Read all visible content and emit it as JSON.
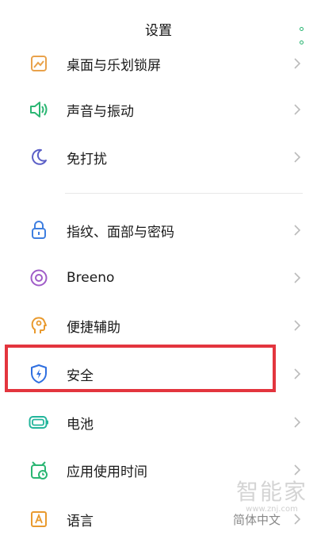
{
  "header": {
    "title": "设置"
  },
  "items": [
    {
      "label": "桌面与乐划锁屏",
      "icon": "wallpaper-icon",
      "color": "#e9a24b"
    },
    {
      "label": "声音与振动",
      "icon": "speaker-icon",
      "color": "#2bb673"
    },
    {
      "label": "免打扰",
      "icon": "moon-icon",
      "color": "#5b5fc7"
    },
    {
      "label": "指纹、面部与密码",
      "icon": "lock-icon",
      "color": "#3f7fe0"
    },
    {
      "label": "Breeno",
      "icon": "breeno-icon",
      "color": "#a05cc8"
    },
    {
      "label": "便捷辅助",
      "icon": "assist-head-icon",
      "color": "#e99a2e"
    },
    {
      "label": "安全",
      "icon": "shield-bolt-icon",
      "color": "#2f6fe0"
    },
    {
      "label": "电池",
      "icon": "battery-icon",
      "color": "#22b59b"
    },
    {
      "label": "应用使用时间",
      "icon": "app-clock-icon",
      "color": "#2bb673"
    },
    {
      "label": "语言",
      "icon": "language-icon",
      "color": "#e99a2e",
      "value": "简体中文"
    }
  ],
  "watermark": {
    "big": "智能家",
    "small": "www.znj.com"
  },
  "colors": {
    "accent": "#2bb673",
    "highlight": "#e3353e"
  }
}
